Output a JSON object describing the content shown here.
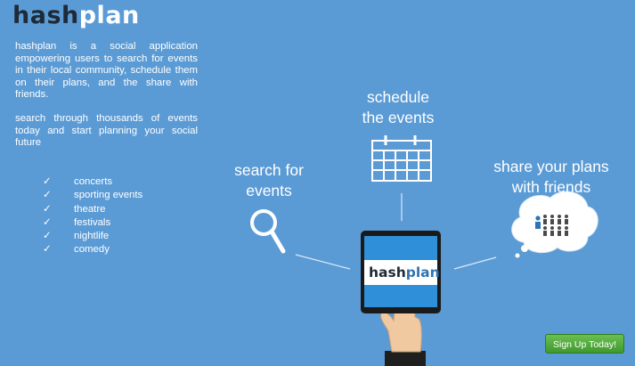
{
  "logo": {
    "part1": "hash",
    "part2": "plan"
  },
  "intro": {
    "paragraph1": "hashplan is a social application empowering users to search for events in their local community, schedule them on their plans, and the share with friends.",
    "paragraph2": "search through thousands of events today and start planning your social future"
  },
  "checklist": {
    "check": "✓",
    "items": [
      "concerts",
      "sporting events",
      "theatre",
      "festivals",
      "nightlife",
      "comedy"
    ]
  },
  "features": {
    "search": {
      "line1": "search for",
      "line2": "events",
      "icon": "magnifier-icon"
    },
    "schedule": {
      "line1": "schedule",
      "line2": "the events",
      "icon": "calendar-icon"
    },
    "share": {
      "line1": "share your plans",
      "line2": "with friends",
      "icon": "people-thought-bubble-icon"
    }
  },
  "tablet": {
    "logo_part1": "hash",
    "logo_part2": "plan"
  },
  "signup_button": "Sign Up Today!",
  "colors": {
    "background": "#5b9bd5",
    "button": "#4aa836",
    "logo_dark": "#1f2a37",
    "logo_blue": "#2e74b5"
  }
}
